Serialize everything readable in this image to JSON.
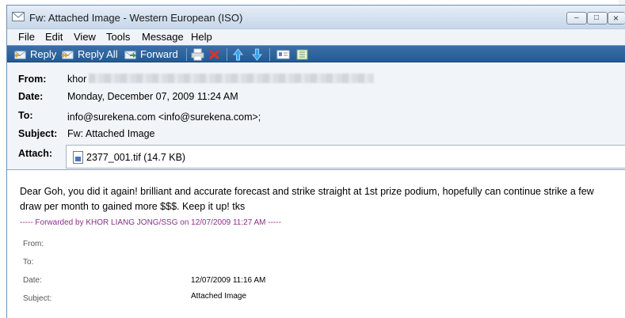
{
  "window": {
    "title": "Fw: Attached Image - Western European (ISO)",
    "controls": {
      "minimize": "–",
      "maximize": "□",
      "close": "×"
    }
  },
  "menu": [
    "File",
    "Edit",
    "View",
    "Tools",
    "Message",
    "Help"
  ],
  "toolbar": {
    "reply": "Reply",
    "reply_all": "Reply All",
    "forward": "Forward",
    "icons": [
      "print-icon",
      "delete-icon",
      "previous-icon",
      "next-icon",
      "address-book-icon",
      "flag-icon"
    ]
  },
  "header": {
    "from_label": "From:",
    "from_value": "khor",
    "date_label": "Date:",
    "date_value": "Monday, December 07, 2009 11:24 AM",
    "to_label": "To:",
    "to_value": "info@surekena.com <info@surekena.com>;",
    "subject_label": "Subject:",
    "subject_value": "Fw: Attached Image",
    "attach_label": "Attach:",
    "attachment": "2377_001.tif (14.7 KB)"
  },
  "body": {
    "text": "Dear Goh, you did it again! brilliant and accurate forecast and strike straight at 1st prize podium, hopefully can continue strike a few draw per month to gained more $$$. Keep it up! tks",
    "forward_line": "----- Forwarded by KHOR LIANG JONG/SSG on 12/07/2009 11:27 AM -----",
    "fwd_fields": [
      {
        "label": "From:",
        "value": ""
      },
      {
        "label": "To:",
        "value": ""
      },
      {
        "label": "Date:",
        "value": "12/07/2009 11:16 AM"
      },
      {
        "label": "Subject:",
        "value": "Attached Image"
      }
    ]
  },
  "colors": {
    "toolbar": "#2b6099",
    "forward_line": "#8b2f8b"
  }
}
